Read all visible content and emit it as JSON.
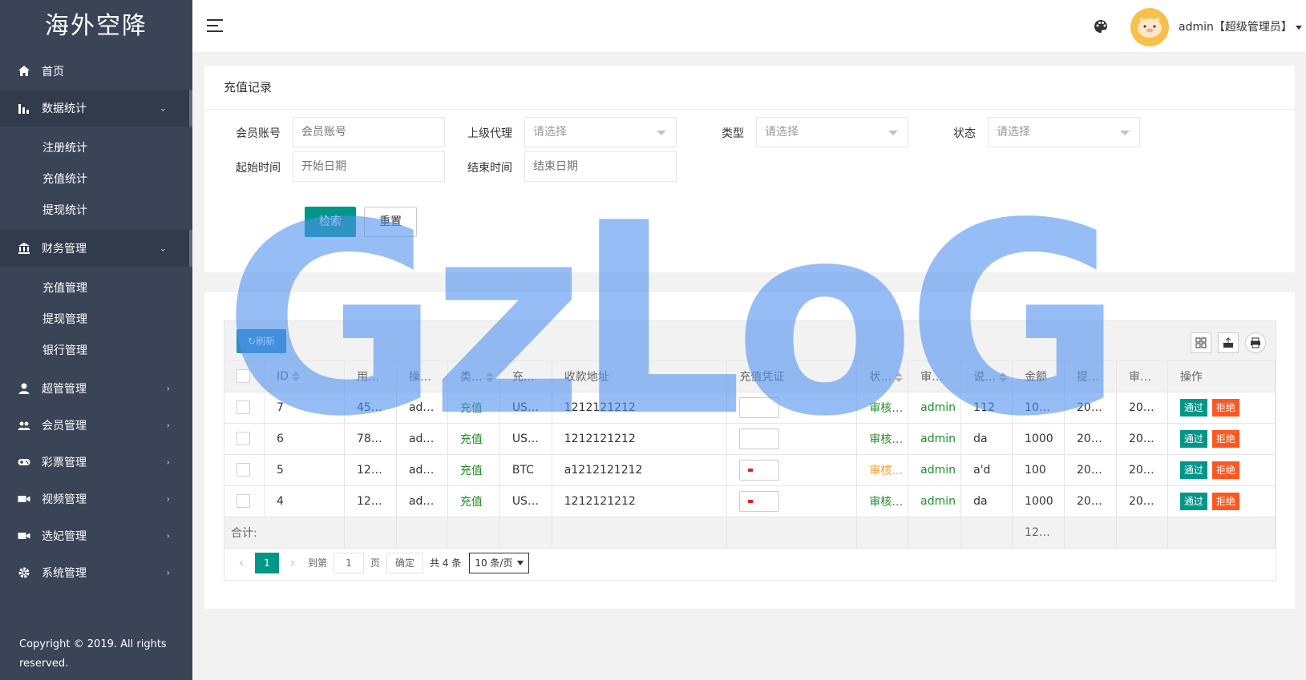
{
  "brand": "海外空降",
  "sidebar": {
    "items": [
      {
        "label": "首页",
        "icon": "home-icon"
      },
      {
        "label": "数据统计",
        "icon": "bar-chart-icon",
        "sub": [
          "注册统计",
          "充值统计",
          "提现统计"
        ]
      },
      {
        "label": "财务管理",
        "icon": "bank-icon",
        "sub": [
          "充值管理",
          "提现管理",
          "银行管理"
        ]
      },
      {
        "label": "超管管理",
        "icon": "user-icon"
      },
      {
        "label": "会员管理",
        "icon": "users-icon"
      },
      {
        "label": "彩票管理",
        "icon": "gamepad-icon"
      },
      {
        "label": "视频管理",
        "icon": "video-icon"
      },
      {
        "label": "选妃管理",
        "icon": "video-icon"
      },
      {
        "label": "系统管理",
        "icon": "gear-icon"
      }
    ],
    "copyright": "Copyright © 2019. All rights reserved."
  },
  "header": {
    "user": "admin【超级管理员】"
  },
  "search_panel": {
    "title": "充值记录",
    "fields": {
      "member_label": "会员账号",
      "member_placeholder": "会员账号",
      "agent_label": "上级代理",
      "agent_value": "请选择",
      "type_label": "类型",
      "type_value": "请选择",
      "status_label": "状态",
      "status_value": "请选择",
      "start_label": "起始时间",
      "start_placeholder": "开始日期",
      "end_label": "结束时间",
      "end_placeholder": "结束日期"
    },
    "search_btn": "检索",
    "reset_btn": "重置"
  },
  "table": {
    "refresh_btn": "刷新",
    "columns": [
      "ID",
      "用…",
      "操…",
      "类…",
      "充…",
      "收款地址",
      "充值凭证",
      "状…",
      "审…",
      "说…",
      "金额",
      "提…",
      "审…",
      "操作"
    ],
    "rows": [
      {
        "id": "7",
        "user": "45…",
        "op": "ad…",
        "type": "充值",
        "coin": "US…",
        "addr": "1212121212",
        "voucher": "blank",
        "status": "审核通过",
        "status_color": "green",
        "auditor": "admin",
        "note": "112",
        "amount": "10…",
        "submit": "20…",
        "audit_time": "20…"
      },
      {
        "id": "6",
        "user": "78…",
        "op": "ad…",
        "type": "充值",
        "coin": "US…",
        "addr": "1212121212",
        "voucher": "blank",
        "status": "审核通过",
        "status_color": "green",
        "auditor": "admin",
        "note": "da",
        "amount": "1000",
        "submit": "20…",
        "audit_time": "20…"
      },
      {
        "id": "5",
        "user": "12…",
        "op": "ad…",
        "type": "充值",
        "coin": "BTC",
        "addr": "a1212121212",
        "voucher": "image",
        "status": "审核拒绝",
        "status_color": "orange",
        "auditor": "admin",
        "note": "a'd",
        "amount": "100",
        "submit": "20…",
        "audit_time": "20…"
      },
      {
        "id": "4",
        "user": "12…",
        "op": "ad…",
        "type": "充值",
        "coin": "US…",
        "addr": "1212121212",
        "voucher": "image",
        "status": "审核通过",
        "status_color": "green",
        "auditor": "admin",
        "note": "da",
        "amount": "1000",
        "submit": "20…",
        "audit_time": "20…"
      }
    ],
    "pass_btn": "通过",
    "reject_btn": "拒绝",
    "sum_label": "合计:",
    "sum_amount": "12…"
  },
  "pager": {
    "current": "1",
    "goto_label": "到第",
    "goto_value": "1",
    "page_label": "页",
    "confirm": "确定",
    "total": "共 4 条",
    "page_size": "10 条/页"
  },
  "watermark": "GzLoG",
  "colors": {
    "sidebar": "#3a4456",
    "primary": "#009688",
    "reject": "#ff5722",
    "refresh": "#2d8cc6",
    "watermark": "#5091ee"
  }
}
